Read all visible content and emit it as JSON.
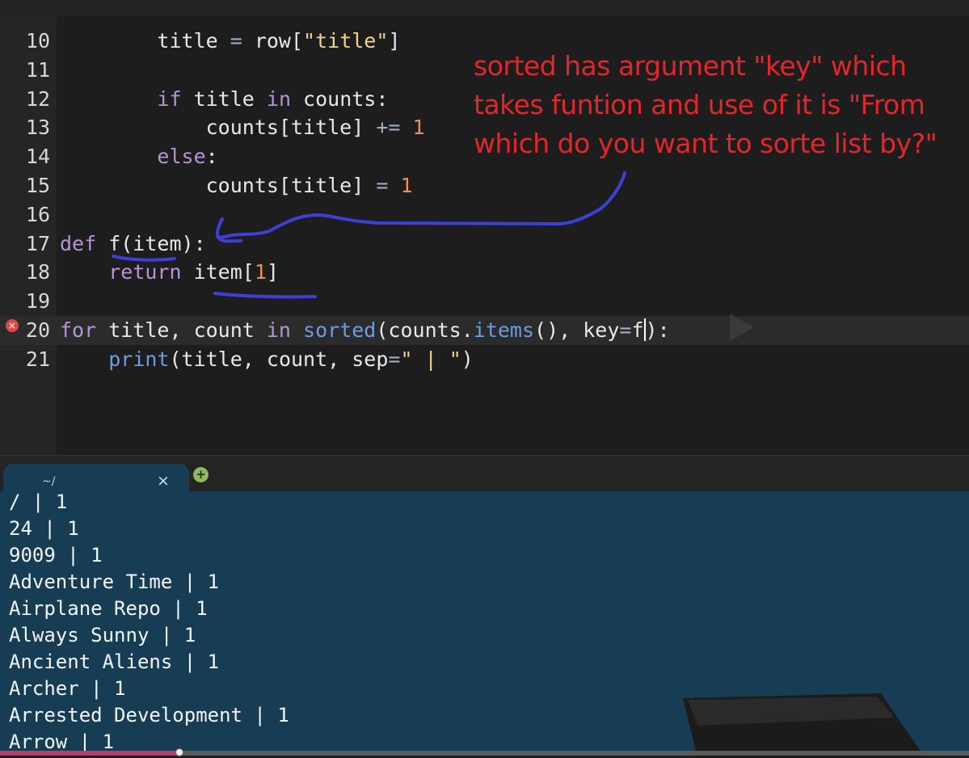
{
  "editor": {
    "lines": [
      {
        "num": "10",
        "parts": [
          {
            "t": "        title "
          },
          {
            "t": "=",
            "c": "op"
          },
          {
            "t": " row["
          },
          {
            "t": "\"title\"",
            "c": "str"
          },
          {
            "t": "]"
          }
        ]
      },
      {
        "num": "11",
        "parts": []
      },
      {
        "num": "12",
        "parts": [
          {
            "t": "        "
          },
          {
            "t": "if",
            "c": "kw"
          },
          {
            "t": " title "
          },
          {
            "t": "in",
            "c": "kw"
          },
          {
            "t": " counts:"
          }
        ]
      },
      {
        "num": "13",
        "parts": [
          {
            "t": "            counts[title] "
          },
          {
            "t": "+=",
            "c": "op"
          },
          {
            "t": " "
          },
          {
            "t": "1",
            "c": "num"
          }
        ]
      },
      {
        "num": "14",
        "parts": [
          {
            "t": "        "
          },
          {
            "t": "else",
            "c": "kw"
          },
          {
            "t": ":"
          }
        ]
      },
      {
        "num": "15",
        "parts": [
          {
            "t": "            counts[title] "
          },
          {
            "t": "=",
            "c": "op"
          },
          {
            "t": " "
          },
          {
            "t": "1",
            "c": "num"
          }
        ]
      },
      {
        "num": "16",
        "parts": []
      },
      {
        "num": "17",
        "parts": [
          {
            "t": "def",
            "c": "kw"
          },
          {
            "t": " f(item):"
          }
        ]
      },
      {
        "num": "18",
        "parts": [
          {
            "t": "    "
          },
          {
            "t": "return",
            "c": "kw"
          },
          {
            "t": " item["
          },
          {
            "t": "1",
            "c": "num"
          },
          {
            "t": "]"
          }
        ]
      },
      {
        "num": "19",
        "parts": []
      },
      {
        "num": "20",
        "active": true,
        "parts": [
          {
            "t": "for",
            "c": "kw"
          },
          {
            "t": " title, count "
          },
          {
            "t": "in",
            "c": "kw"
          },
          {
            "t": " "
          },
          {
            "t": "sorted",
            "c": "fn"
          },
          {
            "t": "(counts."
          },
          {
            "t": "items",
            "c": "fn"
          },
          {
            "t": "(), key"
          },
          {
            "t": "=",
            "c": "op"
          },
          {
            "t": "f"
          },
          {
            "t": "|caret|"
          },
          {
            "t": "):"
          }
        ]
      },
      {
        "num": "21",
        "parts": [
          {
            "t": "    "
          },
          {
            "t": "print",
            "c": "fn"
          },
          {
            "t": "(title, count, sep"
          },
          {
            "t": "=",
            "c": "op"
          },
          {
            "t": "\" | \"",
            "c": "str"
          },
          {
            "t": ")"
          }
        ]
      }
    ],
    "error_marker": "×"
  },
  "annotation": {
    "lines": [
      "sorted has argument \"key\" which",
      "takes funtion and use of it is \"From",
      "which do you want to sorte list by?\""
    ],
    "color": "#e2262c",
    "ink_color": "#3d3fd8"
  },
  "terminal": {
    "tab_label": "~/",
    "close_glyph": "×",
    "new_tab_glyph": "+",
    "output": [
      "/ | 1",
      "24 | 1",
      "9009 | 1",
      "Adventure Time | 1",
      "Airplane Repo | 1",
      "Always Sunny | 1",
      "Ancient Aliens | 1",
      "Archer | 1",
      "Arrested Development | 1",
      "Arrow | 1"
    ]
  },
  "colors": {
    "editor_bg": "#1d1d1d",
    "terminal_bg": "#173d54",
    "keyword": "#b794d6",
    "function": "#6d9ce0",
    "string": "#f0d48a",
    "number": "#e3945b"
  }
}
